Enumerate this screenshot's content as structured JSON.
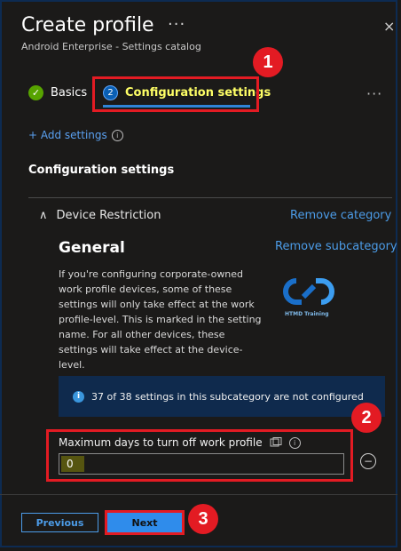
{
  "header": {
    "title": "Create profile",
    "more": "···",
    "close": "×",
    "subtitle": "Android Enterprise - Settings catalog"
  },
  "steps": {
    "basics": {
      "label": "Basics",
      "check": "✓"
    },
    "config": {
      "number": "2",
      "label": "Configuration settings"
    },
    "more": "···"
  },
  "add_settings": {
    "label": "+ Add settings",
    "info": "i"
  },
  "section_title": "Configuration settings",
  "category": {
    "chevron": "∧",
    "name": "Device Restriction",
    "remove": "Remove category"
  },
  "subcategory": {
    "title": "General",
    "remove": "Remove subcategory",
    "description": "If you're configuring corporate-owned work profile devices, some of these settings will only take effect at the work profile-level. This is marked in the setting name. For all other devices, these settings will take effect at the device-level."
  },
  "logo": {
    "text": "HTMD Training"
  },
  "banner": {
    "icon": "i",
    "text": "37 of 38 settings in this subcategory are not configured"
  },
  "setting": {
    "label": "Maximum days to turn off work profile",
    "info": "i",
    "value": "0",
    "remove_icon": "−"
  },
  "footer": {
    "previous": "Previous",
    "next": "Next"
  },
  "annotations": {
    "b1": "1",
    "b2": "2",
    "b3": "3"
  },
  "colors": {
    "background": "#1b1a19",
    "accent": "#4c9ce8",
    "annotation_red": "#e31b23",
    "highlight_yellow": "#ffff66",
    "success_green": "#57a300"
  }
}
